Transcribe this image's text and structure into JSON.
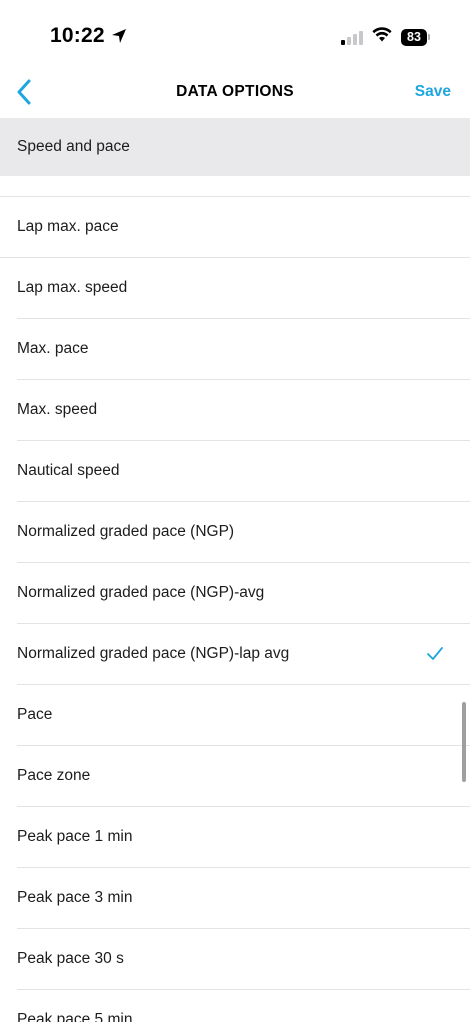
{
  "status_bar": {
    "time": "10:22",
    "battery": "83"
  },
  "nav": {
    "title": "DATA OPTIONS",
    "save_label": "Save",
    "accent_color": "#1ea6e0"
  },
  "section": {
    "title": "Speed and pace"
  },
  "items": [
    {
      "label": "Lap max. pace",
      "selected": false
    },
    {
      "label": "Lap max. speed",
      "selected": false
    },
    {
      "label": "Max. pace",
      "selected": false
    },
    {
      "label": "Max. speed",
      "selected": false
    },
    {
      "label": "Nautical speed",
      "selected": false
    },
    {
      "label": "Normalized graded pace (NGP)",
      "selected": false
    },
    {
      "label": "Normalized graded pace (NGP)-avg",
      "selected": false
    },
    {
      "label": "Normalized graded pace (NGP)-lap avg",
      "selected": true
    },
    {
      "label": "Pace",
      "selected": false
    },
    {
      "label": "Pace zone",
      "selected": false
    },
    {
      "label": "Peak pace 1 min",
      "selected": false
    },
    {
      "label": "Peak pace 3 min",
      "selected": false
    },
    {
      "label": "Peak pace 30 s",
      "selected": false
    },
    {
      "label": "Peak pace 5 min",
      "selected": false
    }
  ]
}
